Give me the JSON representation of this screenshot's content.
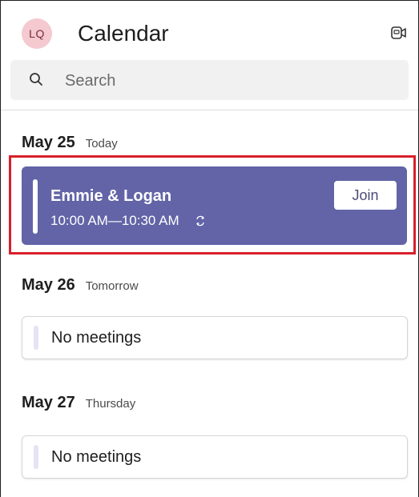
{
  "header": {
    "avatar_initials": "LQ",
    "title": "Calendar",
    "meet_icon": "video-meet-icon"
  },
  "search": {
    "placeholder": "Search",
    "value": ""
  },
  "days": [
    {
      "date": "May 25",
      "label": "Today",
      "meeting": {
        "title": "Emmie & Logan",
        "time": "10:00 AM—10:30 AM",
        "recurring_icon": "repeat-icon",
        "join_label": "Join",
        "color": "#6264a7"
      }
    },
    {
      "date": "May 26",
      "label": "Tomorrow",
      "empty_text": "No meetings"
    },
    {
      "date": "May 27",
      "label": "Thursday",
      "empty_text": "No meetings"
    }
  ],
  "colors": {
    "accent": "#6264a7",
    "highlight": "#d8202a",
    "avatar_bg": "#f4c9cf"
  }
}
